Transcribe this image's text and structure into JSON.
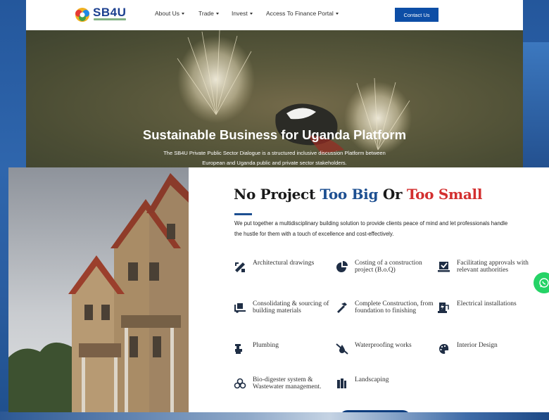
{
  "header": {
    "logo_text": "SB4U",
    "nav": [
      {
        "label": "About Us",
        "dropdown": true
      },
      {
        "label": "Trade",
        "dropdown": true
      },
      {
        "label": "Invest",
        "dropdown": true
      },
      {
        "label": "Access To Finance Portal",
        "dropdown": true
      }
    ],
    "contact_label": "Contact Us"
  },
  "hero": {
    "title": "Sustainable Business for Uganda Platform",
    "subtitle_line1": "The SB4U Private Public Sector Dialogue is a structured inclusive discussion Platform between",
    "subtitle_line2": "European and Uganda public and private sector stakeholders."
  },
  "services_section": {
    "title_part1": "No Project ",
    "title_part2": "Too Big",
    "title_part3": " Or ",
    "title_part4": "Too Small",
    "intro": "We put together a multidisciplinary building solution to provide clients peace of mind and let professionals handle the hustle for them with a touch of excellence and cost-effectively.",
    "items": [
      {
        "label": "Architectural drawings",
        "icon": "drafting-tools-icon"
      },
      {
        "label": "Costing of a construction project (B.o.Q)",
        "icon": "pie-chart-icon"
      },
      {
        "label": "Facilitating approvals with relevant authorities",
        "icon": "approval-checkbox-icon"
      },
      {
        "label": "Consolidating & sourcing of building materials",
        "icon": "truck-loading-icon"
      },
      {
        "label": "Complete Construction, from foundation to finishing",
        "icon": "hammer-icon"
      },
      {
        "label": "Electrical installations",
        "icon": "charging-station-icon"
      },
      {
        "label": "Plumbing",
        "icon": "faucet-icon"
      },
      {
        "label": "Waterproofing works",
        "icon": "water-slash-icon"
      },
      {
        "label": "Interior Design",
        "icon": "palette-icon"
      },
      {
        "label": "Bio-digester system & Wastewater management.",
        "icon": "biohazard-icon"
      },
      {
        "label": "Landscaping",
        "icon": "trees-icon"
      }
    ]
  },
  "colors": {
    "brand_blue": "#1d4f91",
    "accent_red": "#d32f2f",
    "button_blue": "#0d4ea6",
    "whatsapp_green": "#25d366"
  }
}
